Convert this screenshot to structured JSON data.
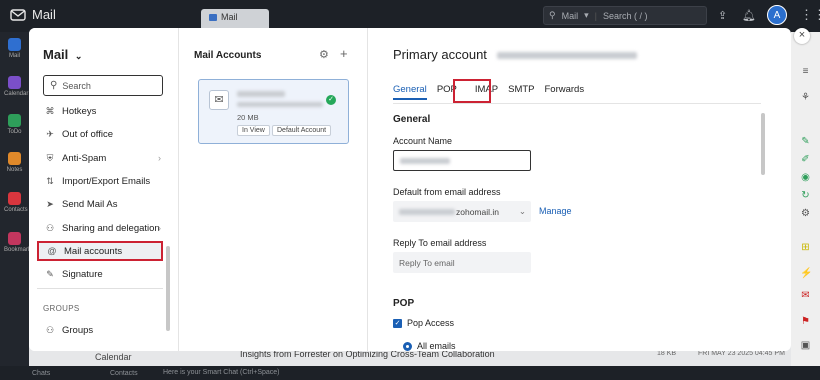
{
  "topbar": {
    "app_name": "Mail",
    "tab_label": "Mail",
    "search_scope": "Mail",
    "search_placeholder": "Search ( / )",
    "avatar_initial": "A"
  },
  "left_rail": [
    {
      "label": "Mail",
      "color": "#2f6fd0"
    },
    {
      "label": "Calendar",
      "color": "#7b4fc9"
    },
    {
      "label": "ToDo",
      "color": "#2e9e5a"
    },
    {
      "label": "Notes",
      "color": "#e0892a"
    },
    {
      "label": "Contacts",
      "color": "#d9363e"
    },
    {
      "label": "Bookmarks",
      "color": "#c2365e"
    }
  ],
  "settings_nav": {
    "title": "Mail",
    "search_placeholder": "Search",
    "items": [
      {
        "label": "Hotkeys",
        "icon": "⌘",
        "arrow": false
      },
      {
        "label": "Out of office",
        "icon": "✈",
        "arrow": false
      },
      {
        "label": "Anti-Spam",
        "icon": "⛨",
        "arrow": true
      },
      {
        "label": "Import/Export Emails",
        "icon": "⇅",
        "arrow": false
      },
      {
        "label": "Send Mail As",
        "icon": "➤",
        "arrow": false
      },
      {
        "label": "Sharing and delegation",
        "icon": "⚇",
        "arrow": true
      },
      {
        "label": "Mail accounts",
        "icon": "@",
        "arrow": false,
        "active": true
      },
      {
        "label": "Signature",
        "icon": "✎",
        "arrow": false
      }
    ],
    "groups_heading": "GROUPS",
    "groups_items": [
      {
        "label": "Groups",
        "icon": "⚇"
      }
    ]
  },
  "accounts_panel": {
    "title": "Mail Accounts",
    "account": {
      "size": "20 MB",
      "tag_in_view": "In View",
      "tag_default": "Default Account"
    }
  },
  "detail": {
    "title": "Primary account",
    "tabs": [
      "General",
      "POP",
      "IMAP",
      "SMTP",
      "Forwards"
    ],
    "active_tab": "General",
    "highlighted_tab": "IMAP",
    "general_heading": "General",
    "account_name_label": "Account Name",
    "default_from_label": "Default from email address",
    "default_from_domain": "zohomail.in",
    "manage_link": "Manage",
    "reply_to_label": "Reply To email address",
    "reply_to_placeholder": "Reply To email",
    "pop_heading": "POP",
    "pop_access_label": "Pop Access",
    "all_emails_label": "All emails"
  },
  "background": {
    "calendar_label": "Calendar",
    "email_subject": "Insights from Forrester on Optimizing Cross-Team Collaboration",
    "email_size": "18 KB",
    "email_date": "FRI MAY 23 2025 04:45 PM",
    "chat_placeholder": "Here is your Smart Chat (Ctrl+Space)",
    "bottom_chats": "Chats",
    "bottom_contacts": "Contacts"
  },
  "colors": {
    "accent": "#1a5fb4",
    "highlight_border": "#cc2233",
    "success": "#25a85a"
  }
}
